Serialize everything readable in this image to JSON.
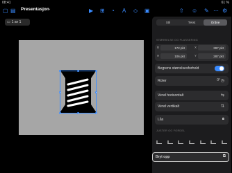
{
  "status": {
    "time": "08:41",
    "date": "tir. 28. mai",
    "right": "61 %"
  },
  "toolbar": {
    "title": "Presentasjon",
    "slides_label": "1 av 1"
  },
  "panel": {
    "tabs": [
      "Stil",
      "Tekst",
      "Ordne"
    ],
    "active_tab": "Ordne",
    "size_section": "STØRRELSE OG PLASSERING",
    "w_label": "B",
    "w_value": "172 pkt",
    "h_label": "H",
    "h_value": "106 pkt",
    "x_label": "X",
    "x_value": "397 pkt",
    "y_label": "Y",
    "y_value": "287 pkt",
    "constrain_label": "Begrens størrelsesforhold",
    "rotate_label": "Roter",
    "rotate_value": "0°",
    "flip_h_label": "Vend horisontalt",
    "flip_v_label": "Vend vertikalt",
    "lock_label": "Lås",
    "distribute_section": "JUSTER OG FORDEL",
    "break_apart_label": "Bryt opp"
  },
  "colors": {
    "accent": "#3a8bff",
    "panel": "#1c1c1e",
    "canvas": "#a6a6a6"
  }
}
